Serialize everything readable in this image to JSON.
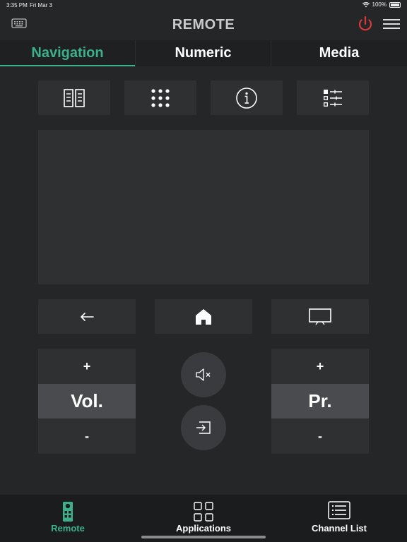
{
  "status": {
    "time": "3:35 PM",
    "date": "Fri Mar 3",
    "battery": "100%"
  },
  "header": {
    "title": "REMOTE",
    "power_color": "#d63a3a"
  },
  "tabs": [
    {
      "label": "Navigation",
      "active": true
    },
    {
      "label": "Numeric",
      "active": false
    },
    {
      "label": "Media",
      "active": false
    }
  ],
  "quick_buttons": [
    "guide-icon",
    "keypad-icon",
    "info-icon",
    "options-list-icon"
  ],
  "nav_buttons": [
    "back-arrow-icon",
    "home-icon",
    "tv-icon"
  ],
  "volume": {
    "plus": "+",
    "label": "Vol.",
    "minus": "-"
  },
  "program": {
    "plus": "+",
    "label": "Pr.",
    "minus": "-"
  },
  "center_buttons": [
    "mute-icon",
    "input-source-icon"
  ],
  "bottom_nav": [
    {
      "label": "Remote",
      "active": true
    },
    {
      "label": "Applications",
      "active": false
    },
    {
      "label": "Channel List",
      "active": false
    }
  ],
  "accent_color": "#3bb08a"
}
